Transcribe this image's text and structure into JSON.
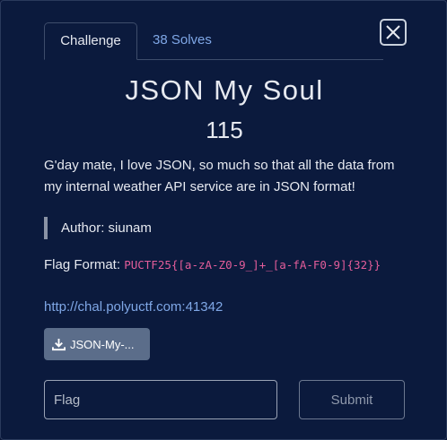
{
  "tabs": [
    {
      "label": "Challenge",
      "active": true
    },
    {
      "label": "38 Solves",
      "active": false
    }
  ],
  "challenge": {
    "title": "JSON My Soul",
    "points": "115",
    "description": "G'day mate, I love JSON, so much so that all the data from my internal weather API service are in JSON format!",
    "author": "Author: siunam",
    "flag_format_label": "Flag Format: ",
    "flag_format_value": "PUCTF25{[a-zA-Z0-9_]+_[a-fA-F0-9]{32}}",
    "link": "http://chal.polyuctf.com:41342",
    "file_label": "JSON-My-..."
  },
  "form": {
    "flag_placeholder": "Flag",
    "submit_label": "Submit"
  },
  "icons": {
    "close": "close-icon",
    "download": "download-icon"
  },
  "colors": {
    "background": "#0b1a3d",
    "link": "#7fa7e6",
    "code": "#e35d9a",
    "file_button": "#5b6d8a"
  }
}
